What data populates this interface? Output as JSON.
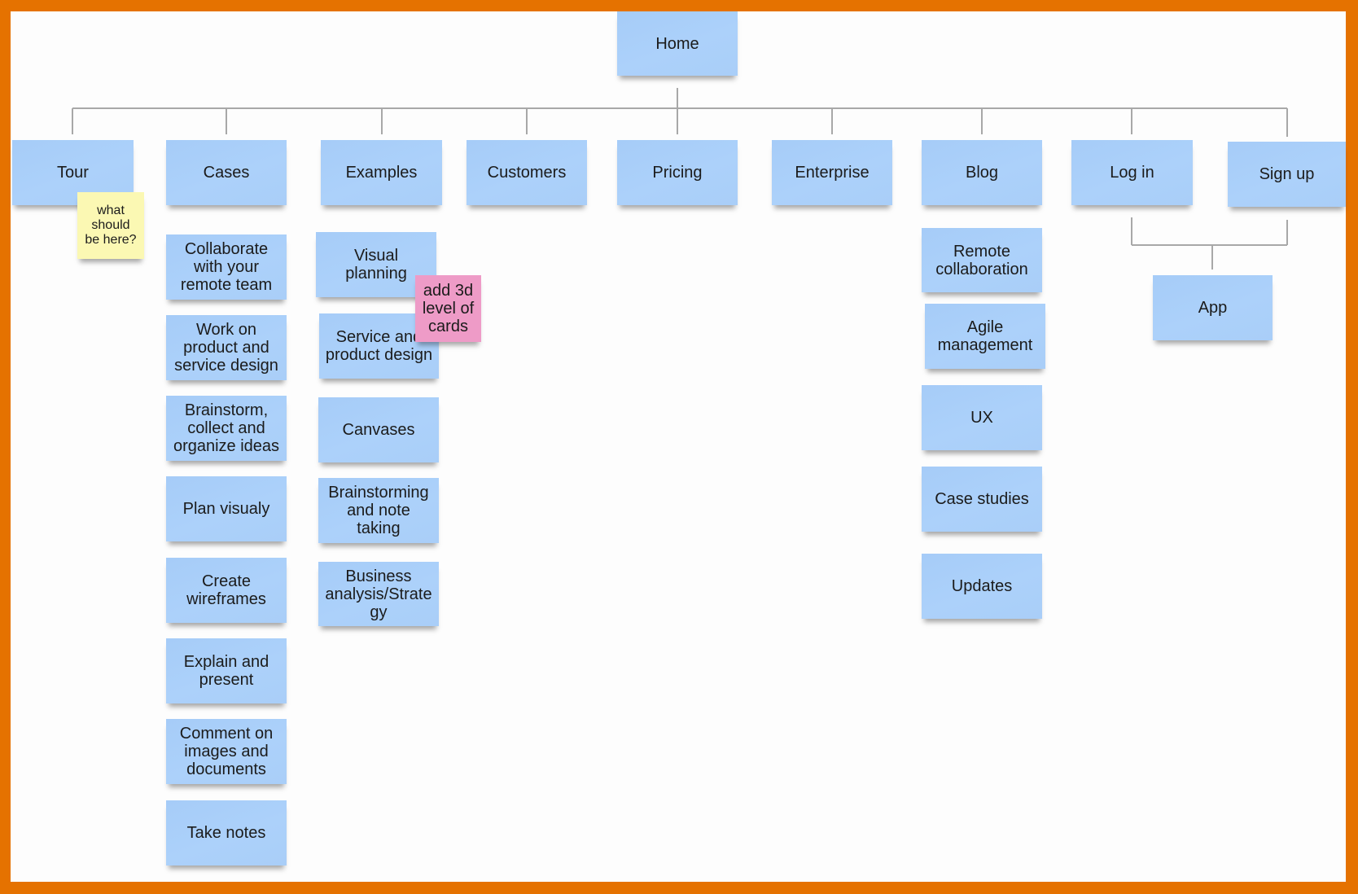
{
  "colors": {
    "frame": "#E57200",
    "board": "#FDFDFD",
    "card": "#A9CEF9",
    "connector": "#A8A8A8",
    "note_yellow": "#FBF8B3",
    "note_pink": "#EE9BC7"
  },
  "root": {
    "label": "Home"
  },
  "sections": [
    {
      "label": "Tour",
      "children": []
    },
    {
      "label": "Cases",
      "children": [
        "Collaborate\nwith your\nremote team",
        "Work on\nproduct and\nservice design",
        "Brainstorm,\ncollect and\norganize ideas",
        "Plan visualy",
        "Create\nwireframes",
        "Explain and\npresent",
        "Comment on\nimages and\ndocuments",
        "Take notes"
      ]
    },
    {
      "label": "Examples",
      "children": [
        "Visual\nplanning",
        "Service and\nproduct design",
        "Canvases",
        "Brainstorming\nand note\ntaking",
        "Business\nanalysis/Strate\ngy"
      ]
    },
    {
      "label": "Customers",
      "children": []
    },
    {
      "label": "Pricing",
      "children": []
    },
    {
      "label": "Enterprise",
      "children": []
    },
    {
      "label": "Blog",
      "children": [
        "Remote\ncollaboration",
        "Agile\nmanagement",
        "UX",
        "Case studies",
        "Updates"
      ]
    },
    {
      "label": "Log in",
      "children": []
    },
    {
      "label": "Sign up",
      "children": []
    }
  ],
  "shared_child": {
    "label": "App",
    "parents": [
      "Log in",
      "Sign up"
    ]
  },
  "notes": [
    {
      "text": "what\nshould\nbe here?",
      "color": "yellow",
      "attached_to": "Tour"
    },
    {
      "text": "add 3d\nlevel of\ncards",
      "color": "pink",
      "attached_to": "Examples"
    }
  ]
}
